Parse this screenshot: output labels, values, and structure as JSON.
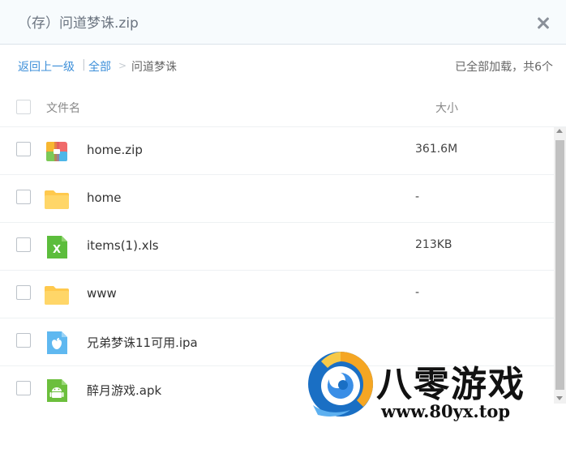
{
  "dialog": {
    "title": "（存）问道梦诛.zip",
    "close_label": "×"
  },
  "nav": {
    "back": "返回上一级",
    "sep1": "|",
    "all": "全部",
    "sep2": ">",
    "current": "问道梦诛",
    "status": "已全部加载，共6个"
  },
  "table": {
    "col_name": "文件名",
    "col_size": "大小"
  },
  "files": [
    {
      "name": "home.zip",
      "size": "361.6M",
      "icon": "zip-archive-icon"
    },
    {
      "name": "home",
      "size": "-",
      "icon": "folder-icon"
    },
    {
      "name": "items(1).xls",
      "size": "213KB",
      "icon": "excel-file-icon"
    },
    {
      "name": "www",
      "size": "-",
      "icon": "folder-icon"
    },
    {
      "name": "兄弟梦诛11可用.ipa",
      "size": "",
      "icon": "ios-app-icon"
    },
    {
      "name": "醉月游戏.apk",
      "size": "",
      "icon": "android-app-icon"
    }
  ],
  "watermark": {
    "brand": "八零游戏",
    "url": "www.80yx.top"
  },
  "colors": {
    "link": "#3d8fd9",
    "folder": "#ffc94d",
    "excel": "#5cbd3c",
    "ios": "#5fb8f0",
    "android": "#6cbf3d"
  }
}
